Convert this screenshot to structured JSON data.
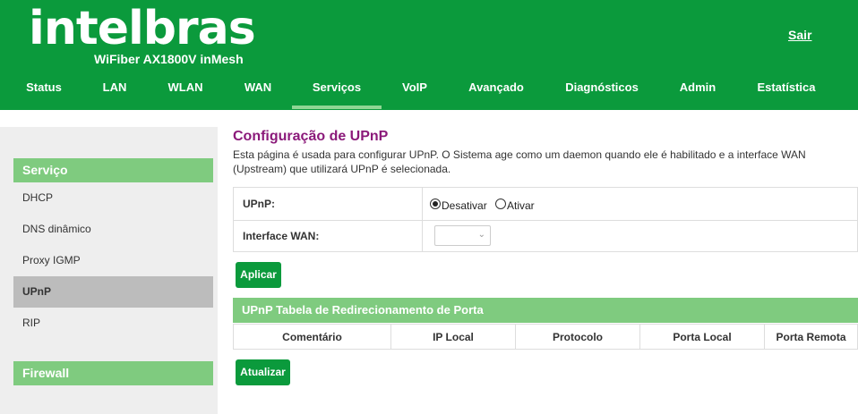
{
  "header": {
    "logo": "intelbras",
    "model": "WiFiber AX1800V inMesh",
    "logout_label": "Sair",
    "nav": [
      {
        "label": "Status"
      },
      {
        "label": "LAN"
      },
      {
        "label": "WLAN"
      },
      {
        "label": "WAN"
      },
      {
        "label": "Serviços",
        "active": true
      },
      {
        "label": "VoIP"
      },
      {
        "label": "Avançado"
      },
      {
        "label": "Diagnósticos"
      },
      {
        "label": "Admin"
      },
      {
        "label": "Estatística"
      }
    ]
  },
  "sidebar": {
    "section1": "Serviço",
    "items": [
      {
        "label": "DHCP"
      },
      {
        "label": "DNS dinâmico"
      },
      {
        "label": "Proxy IGMP"
      },
      {
        "label": "UPnP",
        "active": true
      },
      {
        "label": "RIP"
      }
    ],
    "section2": "Firewall"
  },
  "main": {
    "title": "Configuração de UPnP",
    "description": "Esta página é usada para configurar UPnP. O Sistema age como um daemon quando ele é habilitado e a interface WAN (Upstream) que utilizará UPnP é selecionada.",
    "upnp_label": "UPnP:",
    "radio_disable": "Desativar",
    "radio_enable": "Ativar",
    "upnp_selected": "Desativar",
    "wan_label": "Interface WAN:",
    "wan_value": "",
    "apply_label": "Aplicar",
    "table_title": "UPnP Tabela de Redirecionamento de Porta",
    "columns": [
      "Comentário",
      "IP Local",
      "Protocolo",
      "Porta Local",
      "Porta Remota"
    ],
    "refresh_label": "Atualizar"
  },
  "colors": {
    "brand_green": "#0b9a3c",
    "light_green": "#7fcb7f",
    "title_purple": "#8b1a7a"
  }
}
